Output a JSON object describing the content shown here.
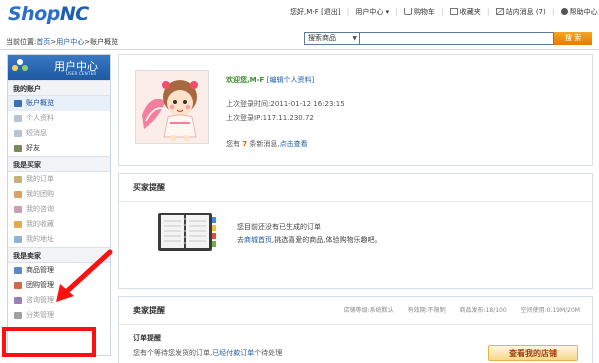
{
  "header": {
    "logo_main": "Shop",
    "logo_accent": "NC",
    "topnav": {
      "greeting": "您好,M-F",
      "logout": "[退出]",
      "user_center": "用户中心",
      "user_center_arrow": "▾",
      "cart": "购物车",
      "favorites": "收藏夹",
      "messages": "站内消息",
      "message_count": "(7)",
      "help": "帮助中心"
    },
    "breadcrumb": {
      "prefix": "当前位置:",
      "home": "首页",
      "sep": ">",
      "center": "用户中心",
      "current": "账户概览"
    },
    "search": {
      "scope": "搜索商品",
      "button": "搜 索"
    }
  },
  "sidebar": {
    "title": "用户中心",
    "subtitle": "USER CENTER",
    "sections": [
      {
        "title": "我的账户",
        "items": [
          {
            "label": "账户概览",
            "state": "active",
            "icon": "home-icon",
            "color": "#3b6fb6"
          },
          {
            "label": "个人资料",
            "state": "muted",
            "icon": "profile-icon",
            "color": "#b8c4d2"
          },
          {
            "label": "短消息",
            "state": "muted",
            "icon": "message-icon",
            "color": "#b8c4d2"
          },
          {
            "label": "好友",
            "state": "dark",
            "icon": "friends-icon",
            "color": "#7a8b5a"
          }
        ]
      },
      {
        "title": "我是买家",
        "items": [
          {
            "label": "我的订单",
            "state": "muted",
            "icon": "order-icon",
            "color": "#c7b07a"
          },
          {
            "label": "我的团购",
            "state": "muted",
            "icon": "group-buy-icon",
            "color": "#d7a36a"
          },
          {
            "label": "我的咨询",
            "state": "muted",
            "icon": "consult-icon",
            "color": "#c9a0b5"
          },
          {
            "label": "我的收藏",
            "state": "muted",
            "icon": "favorite-icon",
            "color": "#e3a94a"
          },
          {
            "label": "我的地址",
            "state": "muted",
            "icon": "address-icon",
            "color": "#8fb2d6"
          }
        ]
      },
      {
        "title": "我是卖家",
        "items": [
          {
            "label": "商品管理",
            "state": "dark",
            "icon": "goods-icon",
            "color": "#5a8ac6"
          },
          {
            "label": "团购管理",
            "state": "dark",
            "icon": "group-manage-icon",
            "color": "#d06a4a"
          },
          {
            "label": "咨询管理",
            "state": "muted",
            "icon": "consult-manage-icon",
            "color": "#9b7fb7"
          },
          {
            "label": "分类管理",
            "state": "muted",
            "icon": "category-icon",
            "color": "#a0a0a0"
          }
        ]
      }
    ]
  },
  "profile": {
    "welcome": "欢迎您,M-F",
    "edit_link": "[编辑个人资料]",
    "last_login_label": "上次登录时间:",
    "last_login_value": "2011-01-12 16:23:15",
    "last_ip_label": "上次登录IP:",
    "last_ip_value": "117.11.230.72",
    "new_msg_prefix": "您有",
    "new_msg_count": "7",
    "new_msg_suffix": "条新消息,",
    "view_link": "点击查看"
  },
  "buyer_panel": {
    "title": "买家提醒",
    "empty_line1": "您目前还没有已生成的订单",
    "empty_line2_prefix": "去",
    "empty_line2_link": "商城首页",
    "empty_line2_suffix": ",挑选喜爱的商品,体验购物乐趣吧。"
  },
  "seller_panel": {
    "title": "卖家提醒",
    "stats": [
      "店铺等级:系统默认",
      "有效期:不限制",
      "商品发布:18/100",
      "空间使用:0.19M/20M"
    ],
    "orders_title": "订单提醒",
    "orders_prefix": "您有",
    "orders_middle": "个等待您发货的订单,",
    "orders_link": "已经付款订单",
    "orders_suffix": "个待处理",
    "store_button": "查看我的店铺"
  },
  "colors": {
    "brand_blue": "#2a6fc9",
    "search_orange": "#e47c00",
    "annotation_red": "#ff1010",
    "welcome_green": "#3e8a2f"
  }
}
